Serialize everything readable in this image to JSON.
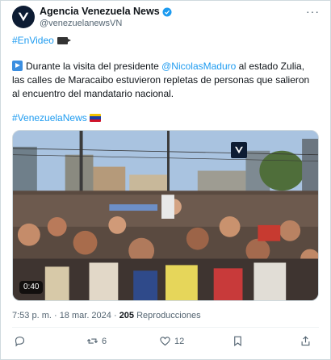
{
  "author": {
    "display_name": "Agencia Venezuela News",
    "handle": "@venezuelanewsVN",
    "avatar_icon": "vn-logo-icon",
    "verified_icon": "verified-badge-icon"
  },
  "post": {
    "line1_hashtag": "#EnVideo",
    "text_prefix": "Durante la visita del presidente ",
    "mention": "@NicolasMaduro",
    "text_suffix": " al estado Zulia, las calles de Maracaibo estuvieron repletas de personas que salieron al encuentro del mandatario nacional.",
    "hashtag2": "#VenezuelaNews",
    "video_duration": "0:40"
  },
  "meta": {
    "time": "7:53 p. m. · 18 mar. 2024 · ",
    "views_count": "205",
    "views_label": " Reproducciones"
  },
  "actions": {
    "reply_count": "",
    "repost_count": "6",
    "like_count": "12"
  },
  "colors": {
    "accent": "#1d9bf0",
    "secondary_text": "#536471",
    "primary_text": "#0f1419"
  }
}
